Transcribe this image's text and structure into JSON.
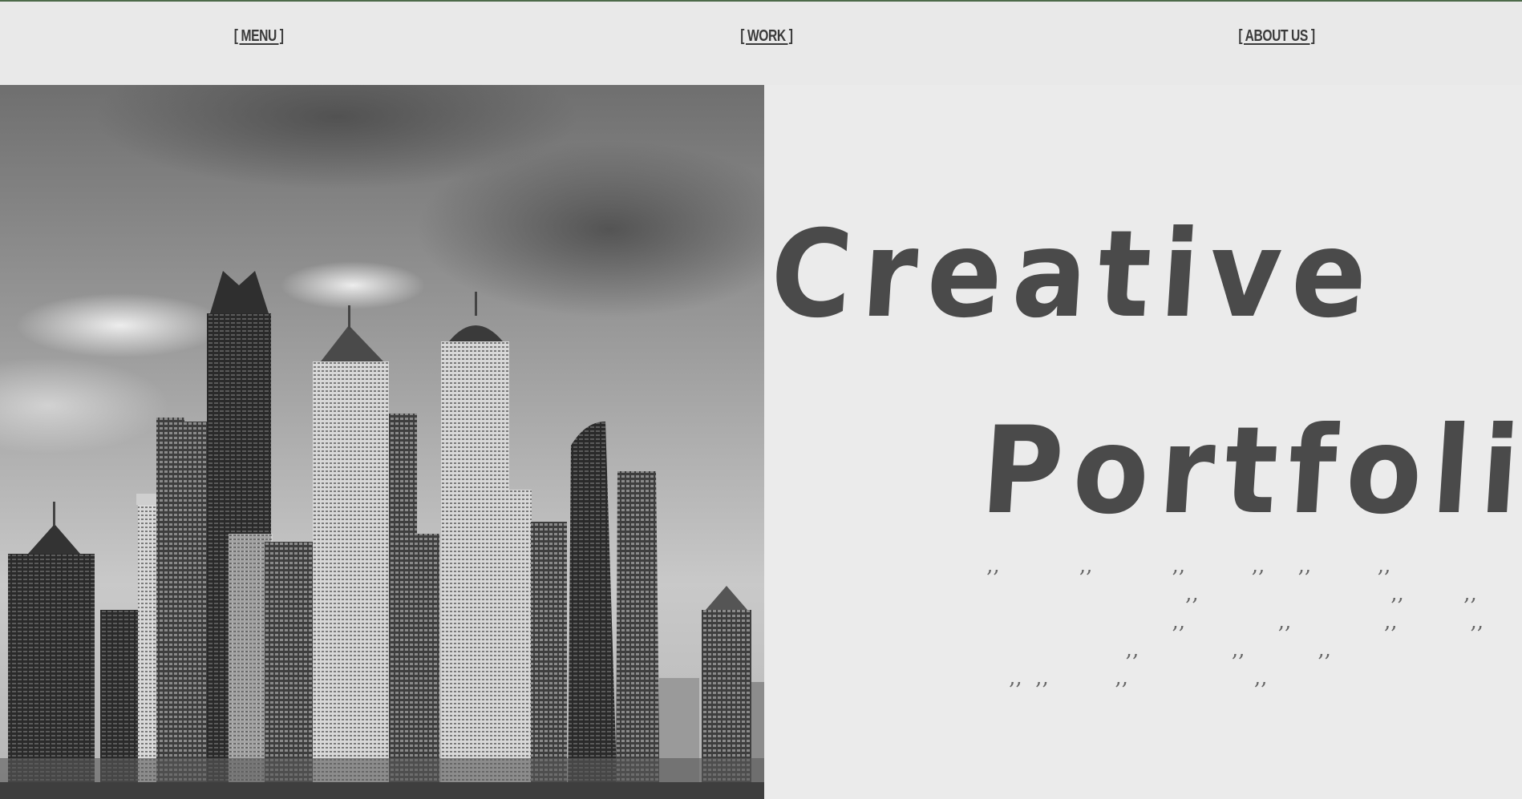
{
  "nav": {
    "menu_label": "[ MENU ]",
    "work_label": "[ WORK ]",
    "about_label": "[ ABOUT US ]"
  },
  "hero": {
    "title_line1": "Creative",
    "title_line2": "Portfolio",
    "text_lines": [
      "‚‚            ‚‚            ‚‚          ‚‚     ‚‚          ‚‚",
      "                              ‚‚                             ‚‚         ‚‚           ‚‚",
      "                            ‚‚              ‚‚              ‚‚           ‚‚",
      "                     ‚‚              ‚‚           ‚‚",
      "‚‚  ‚‚          ‚‚                   ‚‚"
    ]
  },
  "colors": {
    "background": "#ebebeb",
    "title_text": "#4a4a4a",
    "nav_text": "#3a3a3a",
    "top_accent": "#4d6b4a"
  },
  "image": {
    "subject": "grayscale city skyline with skyscrapers under a cloudy sky"
  }
}
